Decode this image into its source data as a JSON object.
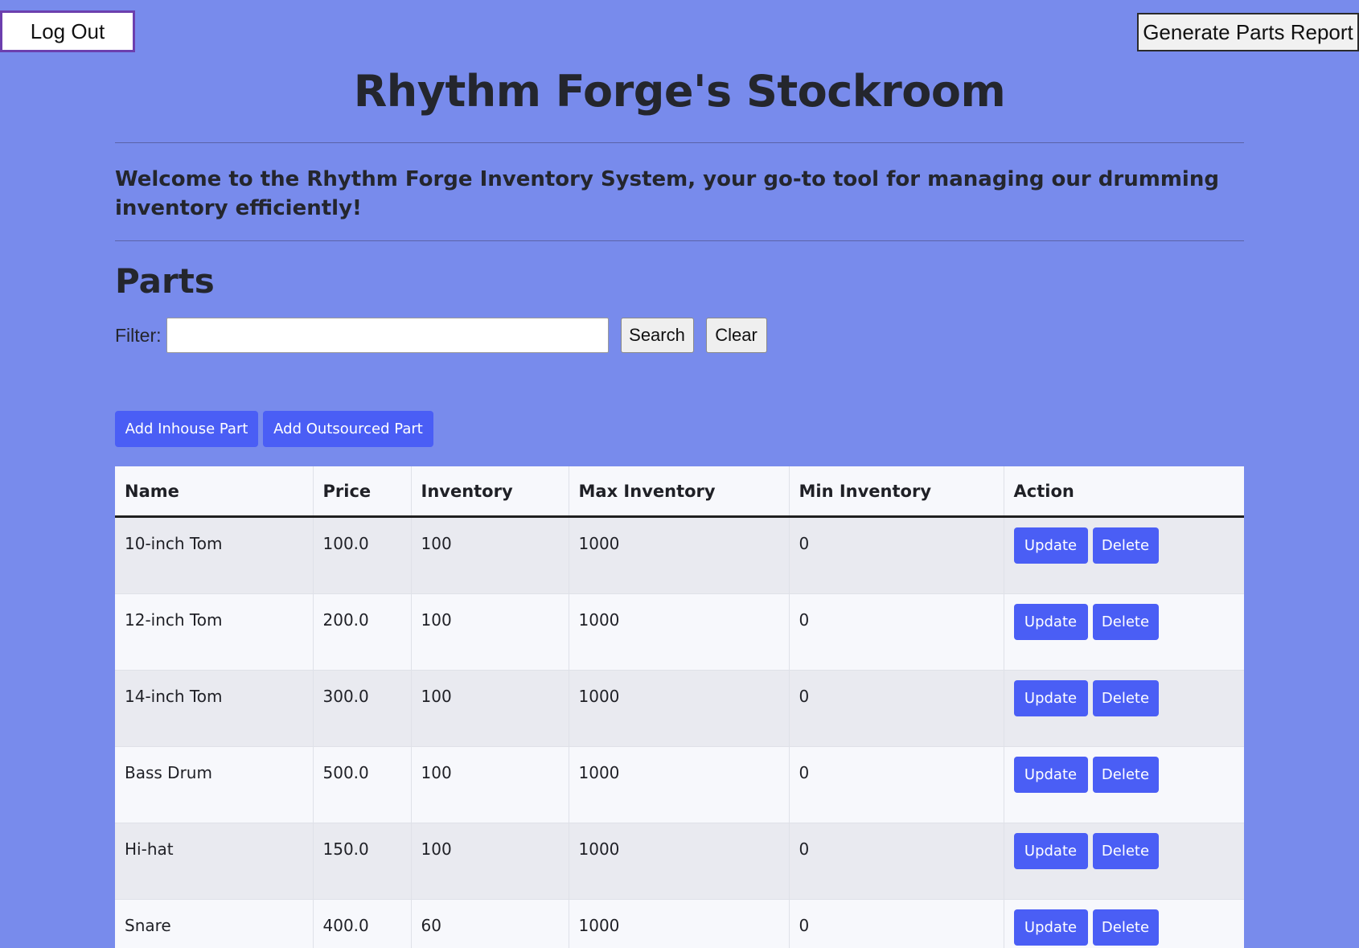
{
  "header": {
    "logout_label": "Log Out",
    "report_label": "Generate Parts Report",
    "title": "Rhythm Forge's Stockroom",
    "welcome": "Welcome to the Rhythm Forge Inventory System, your go-to tool for managing our drumming inventory efficiently!"
  },
  "parts": {
    "heading": "Parts",
    "filter_label": "Filter:",
    "filter_value": "",
    "search_label": "Search",
    "clear_label": "Clear",
    "add_inhouse_label": "Add Inhouse Part",
    "add_outsourced_label": "Add Outsourced Part",
    "columns": [
      "Name",
      "Price",
      "Inventory",
      "Max Inventory",
      "Min Inventory",
      "Action"
    ],
    "update_label": "Update",
    "delete_label": "Delete",
    "rows": [
      {
        "name": "10-inch Tom",
        "price": "100.0",
        "inventory": "100",
        "max": "1000",
        "min": "0"
      },
      {
        "name": "12-inch Tom",
        "price": "200.0",
        "inventory": "100",
        "max": "1000",
        "min": "0"
      },
      {
        "name": "14-inch Tom",
        "price": "300.0",
        "inventory": "100",
        "max": "1000",
        "min": "0"
      },
      {
        "name": "Bass Drum",
        "price": "500.0",
        "inventory": "100",
        "max": "1000",
        "min": "0"
      },
      {
        "name": "Hi-hat",
        "price": "150.0",
        "inventory": "100",
        "max": "1000",
        "min": "0"
      },
      {
        "name": "Snare",
        "price": "400.0",
        "inventory": "60",
        "max": "1000",
        "min": "0"
      }
    ]
  },
  "colors": {
    "background": "#788bec",
    "accent_button": "#4a5ef5",
    "text": "#24262d"
  }
}
